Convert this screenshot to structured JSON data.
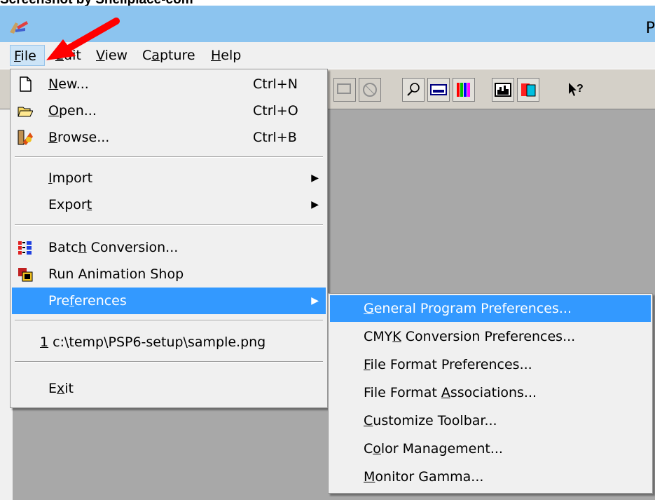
{
  "caption": "Screenshot by Shellplace-com",
  "window": {
    "title_fragment": "P"
  },
  "menubar": {
    "items": [
      {
        "label_u": "F",
        "label_rest": "ile"
      },
      {
        "label_u": "E",
        "label_rest": "dit"
      },
      {
        "label_u": "V",
        "label_rest": "iew"
      },
      {
        "label_pre": "C",
        "label_u": "a",
        "label_rest": "pture"
      },
      {
        "label_u": "H",
        "label_rest": "elp"
      }
    ]
  },
  "file_menu": {
    "new": {
      "u": "N",
      "rest": "ew...",
      "accel": "Ctrl+N"
    },
    "open": {
      "u": "O",
      "rest": "pen...",
      "accel": "Ctrl+O"
    },
    "browse": {
      "u": "B",
      "rest": "rowse...",
      "accel": "Ctrl+B"
    },
    "import": {
      "u": "I",
      "rest": "mport"
    },
    "export": {
      "pre": "Expor",
      "u": "t"
    },
    "batch": {
      "pre": "Batc",
      "u": "h",
      "rest": " Conversion..."
    },
    "run_anim": {
      "label": "Run Animation Shop"
    },
    "prefs": {
      "pre": "Pre",
      "u": "f",
      "rest": "erences"
    },
    "recent": {
      "u": "1",
      "rest": " c:\\temp\\PSP6-setup\\sample.png"
    },
    "exit": {
      "pre": "E",
      "u": "x",
      "rest": "it"
    }
  },
  "prefs_submenu": {
    "general": {
      "u": "G",
      "rest": "eneral Program Preferences..."
    },
    "cmyk": {
      "pre": "CMY",
      "u": "K",
      "rest": " Conversion Preferences..."
    },
    "ffp": {
      "u": "F",
      "rest": "ile Format Preferences..."
    },
    "ffa": {
      "pre": "File Format ",
      "u": "A",
      "rest": "ssociations..."
    },
    "toolbar": {
      "u": "C",
      "rest": "ustomize Toolbar..."
    },
    "color": {
      "pre": "C",
      "u": "o",
      "rest": "lor Management..."
    },
    "gamma": {
      "u": "M",
      "rest": "onitor Gamma..."
    }
  },
  "icons": [
    "app-icon",
    "new-file-icon",
    "open-folder-icon",
    "browse-icon",
    "batch-icon",
    "animation-shop-icon",
    "red-arrow-annotation",
    "toolbar-icons"
  ],
  "colors": {
    "highlight": "#3399ff",
    "titlebar": "#8cc4ef",
    "workspace": "#a8a8a8",
    "arrow": "#ff0000"
  }
}
